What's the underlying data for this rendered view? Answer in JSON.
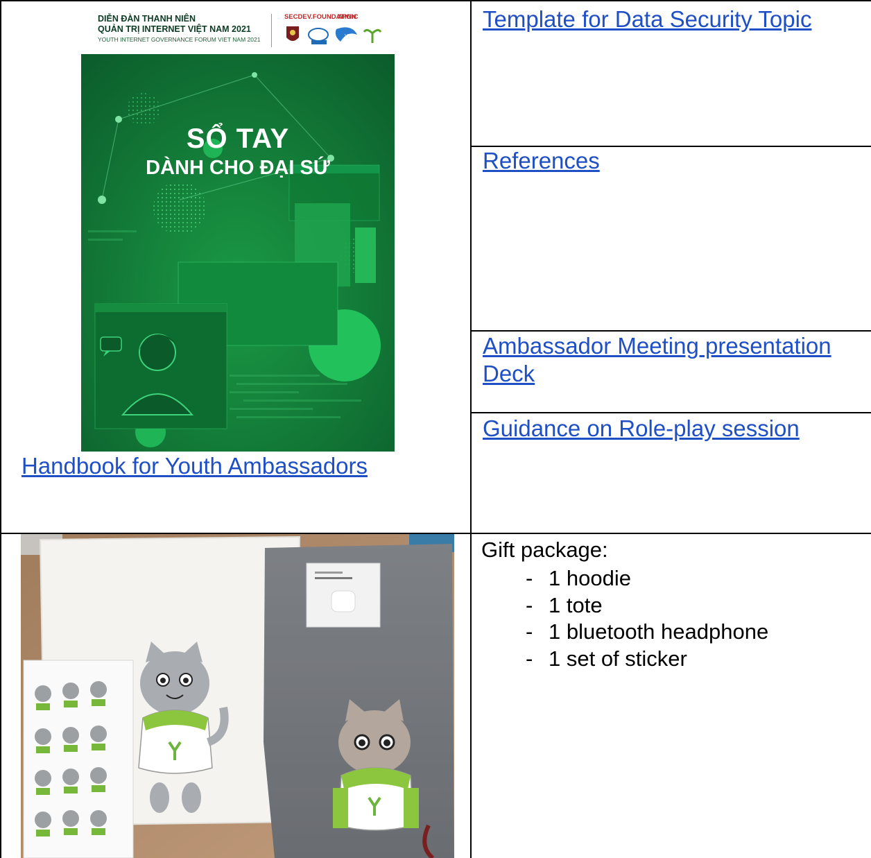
{
  "handbook": {
    "cover": {
      "org_line_1": "DIỄN ĐÀN THANH NIÊN",
      "org_line_2": "QUẢN TRỊ INTERNET VIỆT NAM 2021",
      "org_line_3": "YOUTH INTERNET GOVERNANCE FORUM VIET NAM 2021",
      "partner_1": "SECDEV.FOUNDATION",
      "partner_2_prefix": "",
      "partner_2_highlight": "APNIC",
      "title_line_1": "SỔ TAY",
      "title_line_2": "DÀNH CHO ĐẠI SỨ",
      "colors": {
        "green": "#138a3b",
        "dark_green": "#0b5a2a",
        "light_green": "#3ec46a"
      }
    },
    "link_label": "Handbook for Youth Ambassadors"
  },
  "resources": [
    {
      "label": "Template for Data Security Topic"
    },
    {
      "label": "References"
    },
    {
      "label_line_1": "Ambassador Meeting presentation",
      "label_line_2": "Deck"
    },
    {
      "label": "Guidance on Role-play session"
    }
  ],
  "gift": {
    "title": "Gift package:",
    "bullet": "-",
    "items": [
      "1 hoodie",
      "1 tote",
      "1 bluetooth headphone",
      "1 set of sticker"
    ]
  },
  "style": {
    "link_color": "#1f4fc4"
  }
}
